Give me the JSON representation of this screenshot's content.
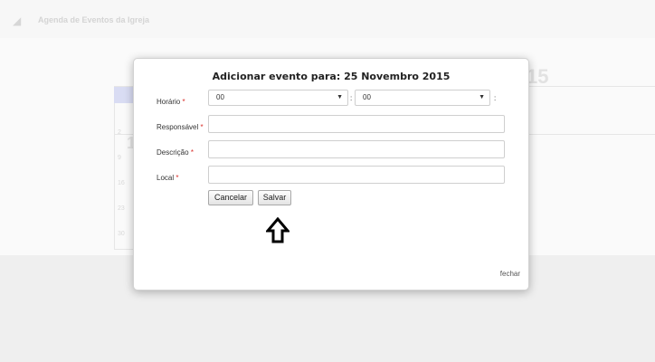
{
  "background": {
    "header_title": "Agenda de Eventos da Igreja",
    "month_partial": "15",
    "week_numbers": [
      "2",
      "9",
      "16",
      "23",
      "30"
    ],
    "big_day": "1"
  },
  "modal": {
    "title": "Adicionar evento para: 25 Novembro 2015",
    "fields": {
      "horario_label": "Horário",
      "responsavel_label": "Responsável",
      "descricao_label": "Descrição",
      "local_label": "Local",
      "required_mark": "*"
    },
    "hour_select": {
      "value": "00"
    },
    "minute_select": {
      "value": "00"
    },
    "time_separator": ":",
    "responsavel_value": "",
    "descricao_value": "",
    "local_value": "",
    "buttons": {
      "cancel": "Cancelar",
      "save": "Salvar"
    },
    "close_link": "fechar"
  }
}
